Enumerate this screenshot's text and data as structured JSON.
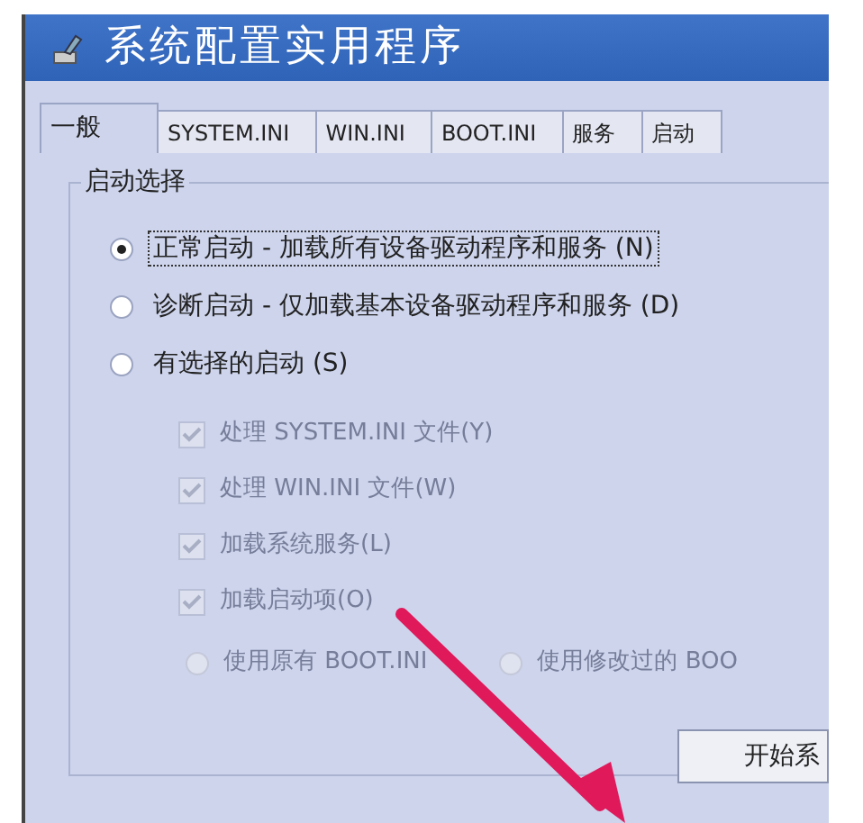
{
  "window": {
    "title": "系统配置实用程序"
  },
  "tabs": [
    {
      "label": "一般",
      "selected": true
    },
    {
      "label": "SYSTEM.INI",
      "selected": false
    },
    {
      "label": "WIN.INI",
      "selected": false
    },
    {
      "label": "BOOT.INI",
      "selected": false
    },
    {
      "label": "服务",
      "selected": false
    },
    {
      "label": "启动",
      "selected": false
    }
  ],
  "startup_group": {
    "legend": "启动选择",
    "options": [
      {
        "label": "正常启动 - 加载所有设备驱动程序和服务 (N)",
        "selected": true,
        "focused": true
      },
      {
        "label": "诊断启动 - 仅加载基本设备驱动程序和服务 (D)",
        "selected": false,
        "focused": false
      },
      {
        "label": "有选择的启动 (S)",
        "selected": false,
        "focused": false
      }
    ],
    "sub_options": [
      {
        "label": "处理 SYSTEM.INI 文件(Y)",
        "checked": true,
        "disabled": true
      },
      {
        "label": "处理 WIN.INI 文件(W)",
        "checked": true,
        "disabled": true
      },
      {
        "label": "加载系统服务(L)",
        "checked": true,
        "disabled": true
      },
      {
        "label": "加载启动项(O)",
        "checked": true,
        "disabled": true
      }
    ],
    "boot_options": [
      {
        "label": "使用原有 BOOT.INI",
        "selected": false,
        "disabled": true
      },
      {
        "label": "使用修改过的 BOO",
        "selected": false,
        "disabled": true
      }
    ]
  },
  "buttons": [
    {
      "label": "开始系"
    }
  ]
}
